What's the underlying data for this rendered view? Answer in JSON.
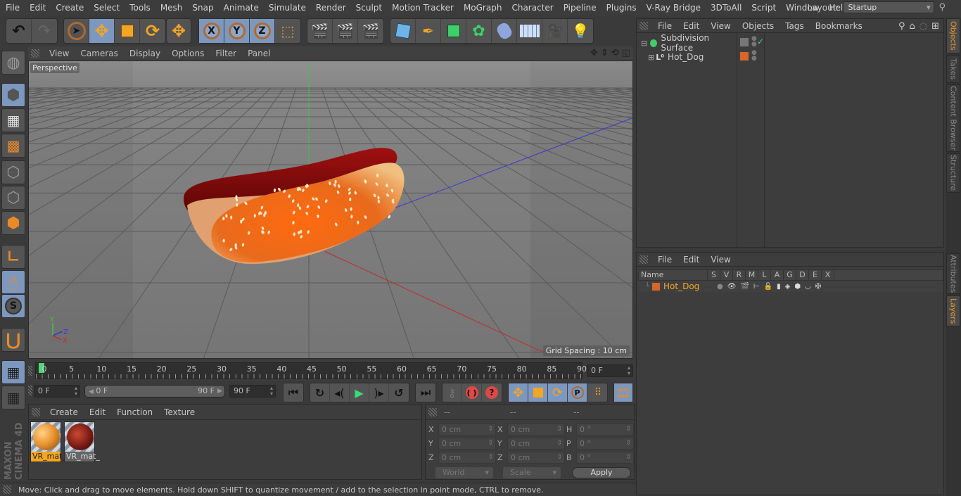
{
  "menubar": {
    "items": [
      "File",
      "Edit",
      "Create",
      "Select",
      "Tools",
      "Mesh",
      "Snap",
      "Animate",
      "Simulate",
      "Render",
      "Sculpt",
      "Motion Tracker",
      "MoGraph",
      "Character",
      "Pipeline",
      "Plugins",
      "V-Ray Bridge",
      "3DToAll",
      "Script",
      "Window",
      "Help"
    ],
    "layout_label": "Layout:",
    "layout_value": "Startup"
  },
  "toolbar": {
    "undo": "undo-icon",
    "redo": "redo-icon",
    "axis_x": "X",
    "axis_y": "Y",
    "axis_z": "Z"
  },
  "viewport": {
    "menu": [
      "View",
      "Cameras",
      "Display",
      "Options",
      "Filter",
      "Panel"
    ],
    "camera_label": "Perspective",
    "grid_spacing": "Grid Spacing : 10 cm",
    "axis_labels": {
      "x": "X",
      "y": "Y",
      "z": "Z"
    },
    "object": "Hot_Dog"
  },
  "timeline": {
    "ticks": [
      "0",
      "5",
      "10",
      "15",
      "20",
      "25",
      "30",
      "35",
      "40",
      "45",
      "50",
      "55",
      "60",
      "65",
      "70",
      "75",
      "80",
      "85",
      "90"
    ],
    "current_frame_field": "0 F",
    "start_field": "0 F",
    "range_start": "0 F",
    "range_end": "90 F",
    "end_field": "90 F",
    "current_frame": 0,
    "max_frame": 90
  },
  "materials": {
    "menu": [
      "Create",
      "Edit",
      "Function",
      "Texture"
    ],
    "items": [
      {
        "label": "VR_mat_",
        "selected": true,
        "color": "#e8902a"
      },
      {
        "label": "VR_mat_",
        "selected": false,
        "color": "#7a1a14"
      }
    ]
  },
  "coordinates": {
    "headers": [
      "--",
      "--",
      "--"
    ],
    "rows": [
      {
        "l1": "X",
        "v1": "0 cm",
        "l2": "X",
        "v2": "0 cm",
        "l3": "H",
        "v3": "0 °"
      },
      {
        "l1": "Y",
        "v1": "0 cm",
        "l2": "Y",
        "v2": "0 cm",
        "l3": "P",
        "v3": "0 °"
      },
      {
        "l1": "Z",
        "v1": "0 cm",
        "l2": "Z",
        "v2": "0 cm",
        "l3": "B",
        "v3": "0 °"
      }
    ],
    "space": "World",
    "mode": "Scale",
    "apply": "Apply"
  },
  "objects_panel": {
    "menu": [
      "File",
      "Edit",
      "View",
      "Objects",
      "Tags",
      "Bookmarks"
    ],
    "items": [
      {
        "name": "Subdivision Surface",
        "level": 0
      },
      {
        "name": "Hot_Dog",
        "level": 1
      }
    ],
    "layer_color": "#d8662a"
  },
  "layers_panel": {
    "menu": [
      "File",
      "Edit",
      "View"
    ],
    "columns": [
      "Name",
      "S",
      "V",
      "R",
      "M",
      "L",
      "A",
      "G",
      "D",
      "E",
      "X"
    ],
    "rows": [
      {
        "name": "Hot_Dog",
        "color": "#d8662a"
      }
    ]
  },
  "side_tabs": {
    "top": [
      "Objects",
      "Takes",
      "Content Browser",
      "Structure"
    ],
    "bottom": [
      "Attributes",
      "Layers"
    ]
  },
  "brand": "MAXON CINEMA 4D",
  "status": "Move: Click and drag to move elements. Hold down SHIFT to quantize movement / add to the selection in point mode, CTRL to remove."
}
